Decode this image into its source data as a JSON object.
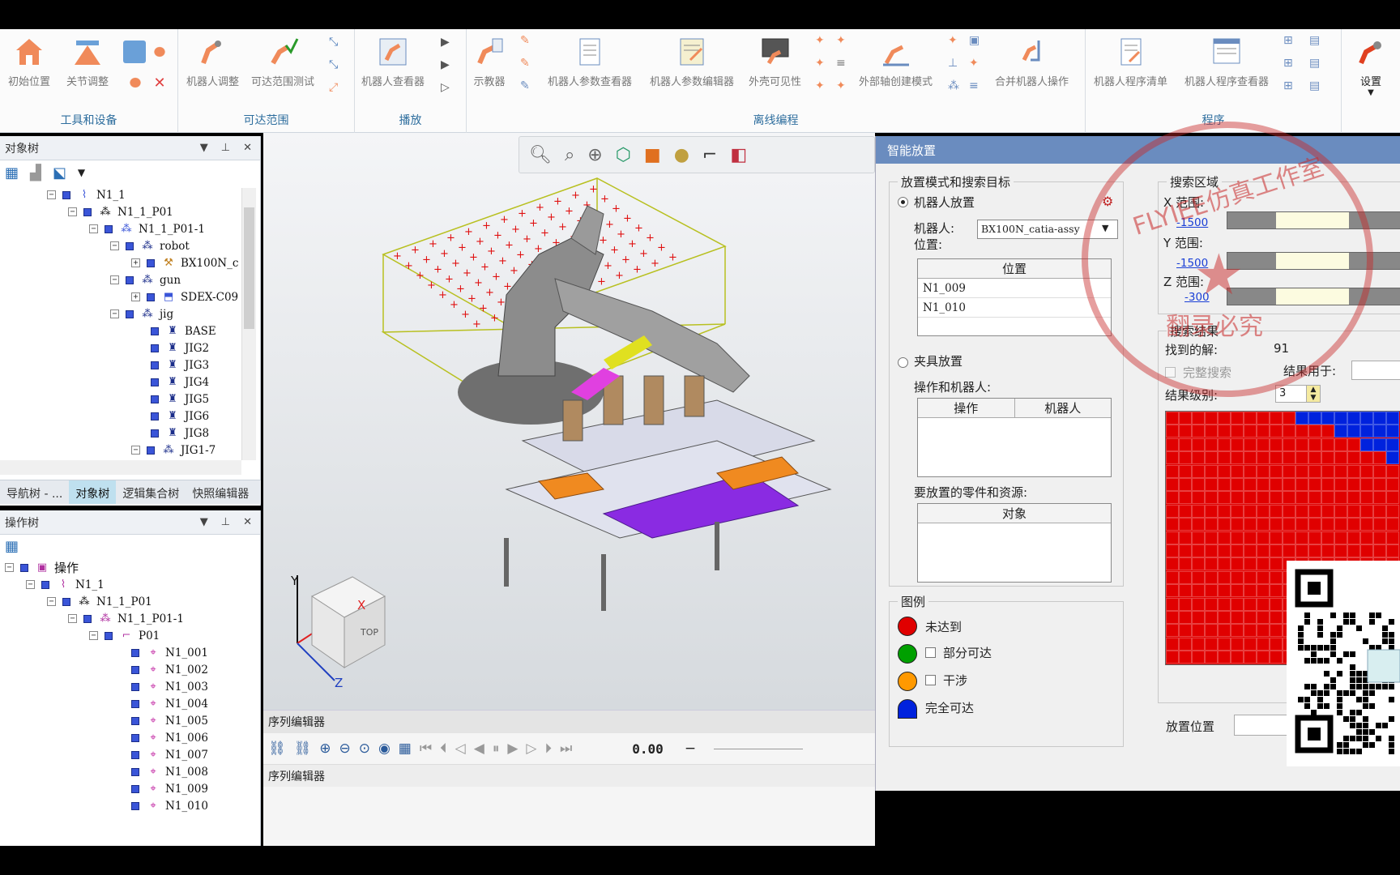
{
  "ribbon": {
    "groups": {
      "tools": "工具和设备",
      "reach": "可达范围",
      "playback": "播放",
      "offline": "离线编程",
      "program": "程序"
    },
    "buttons": {
      "home": "初始位置",
      "joint": "关节调整",
      "robot_adjust": "机器人调整",
      "reach_test": "可达范围测试",
      "robot_viewer": "机器人查看器",
      "teach": "示教器",
      "param_viewer": "机器人参数查看器",
      "param_editor": "机器人参数编辑器",
      "shell_visibility": "外壳可见性",
      "ext_axis": "外部轴创建模式",
      "merge_robot": "合并机器人操作",
      "program_list": "机器人程序清单",
      "program_viewer": "机器人程序查看器",
      "settings": "设置"
    }
  },
  "object_tree": {
    "title": "对象树",
    "rows": [
      "N1_1",
      "N1_1_P01",
      "N1_1_P01-1",
      "robot",
      "BX100N_c",
      "gun",
      "SDEX-C09",
      "jig",
      "BASE",
      "JIG2",
      "JIG3",
      "JIG4",
      "JIG5",
      "JIG6",
      "JIG8",
      "JIG1-7"
    ],
    "tabs": [
      "导航树 - ...",
      "对象树",
      "逻辑集合树",
      "快照编辑器"
    ]
  },
  "operation_tree": {
    "title": "操作树",
    "root": "操作",
    "rows": [
      "N1_1",
      "N1_1_P01",
      "N1_1_P01-1",
      "P01",
      "N1_001",
      "N1_002",
      "N1_003",
      "N1_004",
      "N1_005",
      "N1_006",
      "N1_007",
      "N1_008",
      "N1_009",
      "N1_010"
    ]
  },
  "sequence": {
    "header": "序列编辑器",
    "title2": "序列编辑器",
    "time": "0.00",
    "minus": "−"
  },
  "viewcube": {
    "face_top": "TOP",
    "axis_x": "X",
    "axis_y": "Y",
    "axis_z": "Z"
  },
  "dialog": {
    "title": "智能放置",
    "mode_group": "放置模式和搜索目标",
    "robot_place": "机器人放置",
    "robot_label": "机器人:",
    "position_label": "位置:",
    "robot_value": "BX100N_catia-assy",
    "positions_header": "位置",
    "positions": [
      "N1_009",
      "N1_010"
    ],
    "fixture_place": "夹具放置",
    "ops_robots_label": "操作和机器人:",
    "ops_col": "操作",
    "robot_col": "机器人",
    "parts_label": "要放置的零件和资源:",
    "object_col": "对象",
    "legend_group": "图例",
    "legend": [
      "未达到",
      "部分可达",
      "干涉",
      "完全可达"
    ],
    "search_area": "搜索区域",
    "x_range": "X 范围:",
    "y_range": "Y 范围:",
    "z_range": "Z 范围:",
    "x_min": "-1500",
    "y_min": "-1500",
    "z_min": "-300",
    "results_group": "搜索结果",
    "found_label": "找到的解:",
    "found_value": "91",
    "full_search": "完整搜索",
    "result_used": "结果用于:",
    "result_level": "结果级别:",
    "level_value": "3",
    "place_position": "放置位置"
  },
  "watermark": {
    "text": "FLYIEE仿真工作室",
    "subtext": "翻录必究"
  },
  "colors": {
    "unreached": "#e00000",
    "partial": "#00a000",
    "collision": "#ff9900",
    "full": "#0022dd"
  }
}
